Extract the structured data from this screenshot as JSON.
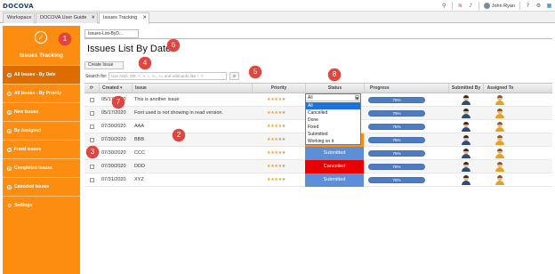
{
  "app": {
    "logo": "DOCOVA"
  },
  "topbar": {
    "user_name": "John Ryan"
  },
  "tabs": [
    {
      "label": "Workspace"
    },
    {
      "label": "DOCOVA User Guide"
    },
    {
      "label": "Issues Tracking"
    }
  ],
  "sidebar": {
    "title": "Issues Tracking",
    "items": [
      {
        "label": "All Issues - By Date"
      },
      {
        "label": "All Issues - By Priority"
      },
      {
        "label": "New Issues"
      },
      {
        "label": "By Assigned"
      },
      {
        "label": "Fixed Issues"
      },
      {
        "label": "Completed Issues"
      },
      {
        "label": "Canceled Issues"
      },
      {
        "label": "Settings"
      }
    ]
  },
  "content": {
    "subtab_label": "Issues-List-ByD...",
    "title": "Issues List By Date",
    "create_button": "Create Issue",
    "search_label": "Search for:",
    "search_placeholder": "Use AND, OR, <, >, =, >=, <= and wildcards like *, ?"
  },
  "table": {
    "headers": {
      "created": "Created",
      "issue": "Issue",
      "priority": "Priority",
      "status": "Status",
      "progress": "Progress",
      "submitted_by": "Submitted By",
      "assigned_to": "Assigned To"
    },
    "rows": [
      {
        "created": "05/17/2020",
        "issue": "This is another issue",
        "priority": 4,
        "status": "",
        "progress": "75%"
      },
      {
        "created": "05/17/2020",
        "issue": "Font used is not showing in read version.",
        "priority": 4,
        "status": "",
        "progress": "75%"
      },
      {
        "created": "07/30/2020",
        "issue": "AAA",
        "priority": 4,
        "status": "",
        "progress": "75%"
      },
      {
        "created": "07/30/2020",
        "issue": "BBB",
        "priority": 3,
        "status": "Fixed",
        "progress": "75%"
      },
      {
        "created": "07/30/2020",
        "issue": "CCC",
        "priority": 4,
        "status": "Submitted",
        "progress": "75%"
      },
      {
        "created": "07/30/2020",
        "issue": "DDD",
        "priority": 4,
        "status": "Cancelled",
        "progress": "75%"
      },
      {
        "created": "07/31/2020",
        "issue": "XYZ",
        "priority": 4,
        "status": "Submitted",
        "progress": "75%"
      }
    ]
  },
  "status_dropdown": {
    "selected": "All",
    "options": [
      "All",
      "Cancelled",
      "Done",
      "Fixed",
      "Submitted",
      "Working on it"
    ]
  },
  "callouts": [
    "1",
    "2",
    "3",
    "4",
    "5",
    "6",
    "7",
    "8"
  ],
  "colors": {
    "sidebar": "#fd8d10",
    "sidebar_active": "#dd6d00",
    "status_fixed": "#fd8d10",
    "status_submitted": "#5c8fd8",
    "status_cancelled": "#e60000",
    "progress": "#4d7cc4",
    "callout": "#e0453f"
  }
}
